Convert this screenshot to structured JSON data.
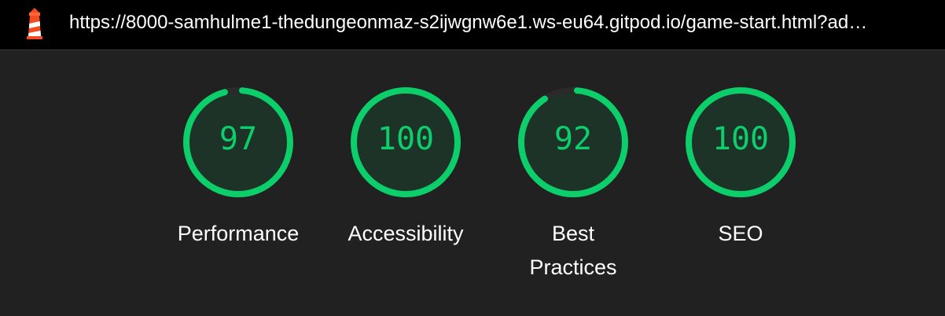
{
  "browser": {
    "url": "https://8000-samhulme1-thedungeonmaz-s2ijwgnw6e1.ws-eu64.gitpod.io/game-start.html?ad…"
  },
  "colors": {
    "pass": "#0cce6b",
    "gauge_fill": "#1e3328",
    "gauge_track": "#2a2a2a"
  },
  "gauges": [
    {
      "score": "97",
      "label_line1": "Performance",
      "label_line2": "",
      "value": 0.97
    },
    {
      "score": "100",
      "label_line1": "Accessibility",
      "label_line2": "",
      "value": 1.0
    },
    {
      "score": "92",
      "label_line1": "Best",
      "label_line2": "Practices",
      "value": 0.92
    },
    {
      "score": "100",
      "label_line1": "SEO",
      "label_line2": "",
      "value": 1.0
    }
  ]
}
